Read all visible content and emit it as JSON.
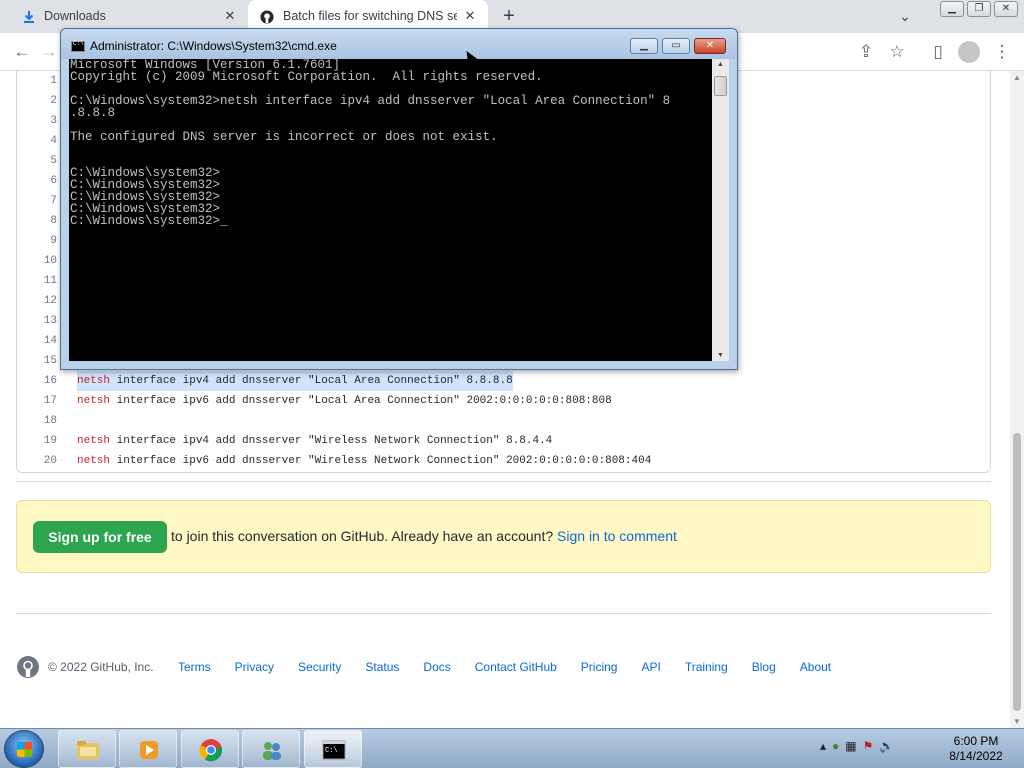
{
  "browser": {
    "tabs": [
      {
        "title": "Downloads",
        "icon": "download-icon"
      },
      {
        "title": "Batch files for switching DNS ser",
        "icon": "github-icon"
      }
    ]
  },
  "code": {
    "lines": [
      {
        "num": "1",
        "kw": "",
        "rest": ""
      },
      {
        "num": "2",
        "kw": "",
        "rest": ""
      },
      {
        "num": "3",
        "kw": "",
        "rest": ""
      },
      {
        "num": "4",
        "kw": "",
        "rest": ""
      },
      {
        "num": "5",
        "kw": "",
        "rest": ""
      },
      {
        "num": "6",
        "kw": "",
        "rest": ""
      },
      {
        "num": "7",
        "kw": "",
        "rest": ""
      },
      {
        "num": "8",
        "kw": "",
        "rest": ""
      },
      {
        "num": "9",
        "kw": "",
        "rest": ""
      },
      {
        "num": "10",
        "kw": "",
        "rest": ""
      },
      {
        "num": "11",
        "kw": "",
        "rest": ""
      },
      {
        "num": "12",
        "kw": "",
        "rest": ""
      },
      {
        "num": "13",
        "kw": "",
        "rest": ""
      },
      {
        "num": "14",
        "kw": "",
        "rest": ""
      },
      {
        "num": "15",
        "kw": "",
        "rest": ""
      },
      {
        "num": "16",
        "kw": "netsh",
        "rest": " interface ipv4 add dnsserver \"Local Area Connection\" 8.8.8.8",
        "highlight": true
      },
      {
        "num": "17",
        "kw": "netsh",
        "rest": " interface ipv6 add dnsserver \"Local Area Connection\" 2002:0:0:0:0:0:808:808"
      },
      {
        "num": "18",
        "kw": "",
        "rest": ""
      },
      {
        "num": "19",
        "kw": "netsh",
        "rest": " interface ipv4 add dnsserver \"Wireless Network Connection\" 8.8.4.4"
      },
      {
        "num": "20",
        "kw": "netsh",
        "rest": " interface ipv6 add dnsserver \"Wireless Network Connection\" 2002:0:0:0:0:0:808:404"
      }
    ]
  },
  "signup": {
    "button": "Sign up for free",
    "join_text": "to join this conversation on GitHub.",
    "account_text": " Already have an account? ",
    "signin_link": "Sign in to comment"
  },
  "footer": {
    "copyright": "© 2022 GitHub, Inc.",
    "links": [
      "Terms",
      "Privacy",
      "Security",
      "Status",
      "Docs",
      "Contact GitHub",
      "Pricing",
      "API",
      "Training",
      "Blog",
      "About"
    ]
  },
  "cmd": {
    "title": "Administrator: C:\\Windows\\System32\\cmd.exe",
    "output": "Microsoft Windows [Version 6.1.7601]\nCopyright (c) 2009 Microsoft Corporation.  All rights reserved.\n\nC:\\Windows\\system32>netsh interface ipv4 add dnsserver \"Local Area Connection\" 8\n.8.8.8\n\nThe configured DNS server is incorrect or does not exist.\n\n\nC:\\Windows\\system32>\nC:\\Windows\\system32>\nC:\\Windows\\system32>\nC:\\Windows\\system32>\nC:\\Windows\\system32>_"
  },
  "taskbar": {
    "clock_time": "6:00 PM",
    "clock_date": "8/14/2022"
  }
}
